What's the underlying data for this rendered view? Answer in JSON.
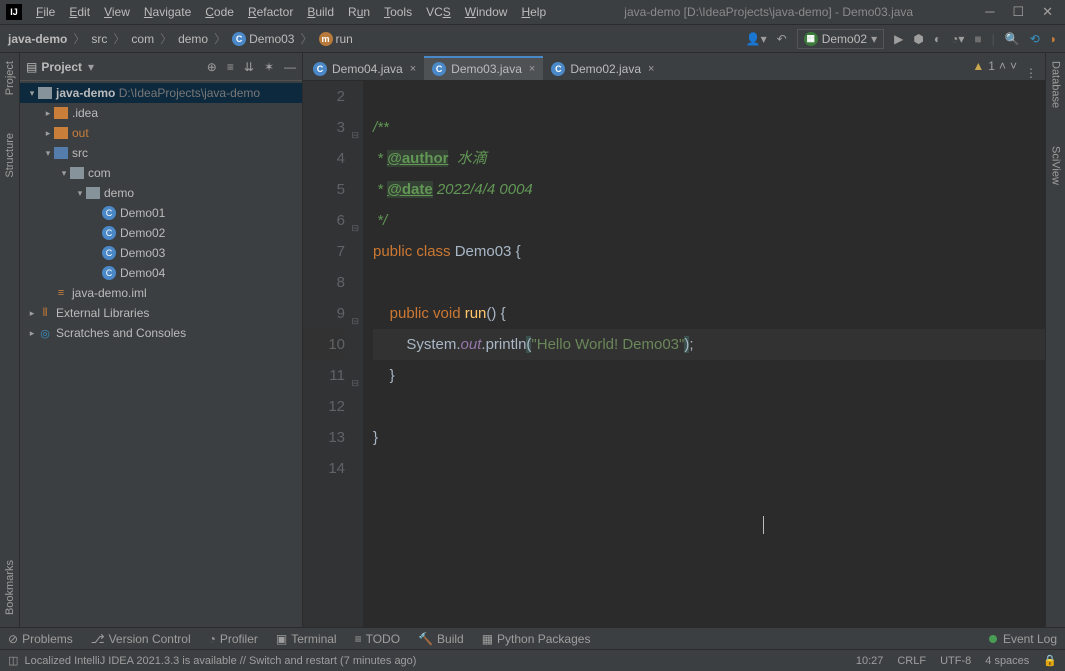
{
  "window": {
    "title": "java-demo [D:\\IdeaProjects\\java-demo] - Demo03.java"
  },
  "menu": [
    "File",
    "Edit",
    "View",
    "Navigate",
    "Code",
    "Refactor",
    "Build",
    "Run",
    "Tools",
    "VCS",
    "Window",
    "Help"
  ],
  "breadcrumb": {
    "project": "java-demo",
    "src": "src",
    "pkg1": "com",
    "pkg2": "demo",
    "class": "Demo03",
    "method": "run"
  },
  "run_config": "Demo02",
  "projectPanel": {
    "title": "Project",
    "root": "java-demo",
    "rootPath": "D:\\IdeaProjects\\java-demo",
    "idea": ".idea",
    "out": "out",
    "src": "src",
    "com": "com",
    "demo": "demo",
    "files": [
      "Demo01",
      "Demo02",
      "Demo03",
      "Demo04"
    ],
    "iml": "java-demo.iml",
    "ext": "External Libraries",
    "scratch": "Scratches and Consoles"
  },
  "leftTabs": [
    "Project",
    "Structure"
  ],
  "leftBottomTab": "Bookmarks",
  "rightTabs": [
    "Database",
    "SciView"
  ],
  "tabs": [
    {
      "name": "Demo04.java",
      "active": false
    },
    {
      "name": "Demo03.java",
      "active": true
    },
    {
      "name": "Demo02.java",
      "active": false
    }
  ],
  "editor": {
    "warnCount": "1",
    "lines": {
      "2": "",
      "3": "/**",
      "4_pre": " * ",
      "4_tag": "@author",
      "4_txt": "  水滴",
      "5_pre": " * ",
      "5_tag": "@date",
      "5_txt": " 2022/4/4 0004",
      "6": " */",
      "7_kw": "public class ",
      "7_cls": "Demo03 ",
      "7_br": "{",
      "8": "",
      "9_ind": "    ",
      "9_kw": "public void ",
      "9_m": "run",
      "9_rest": "() {",
      "10_ind": "        ",
      "10_sys": "System.",
      "10_out": "out",
      "10_dot": ".",
      "10_meth": "println",
      "10_p1": "(",
      "10_str": "\"Hello World! Demo03\"",
      "10_p2": ")",
      "10_semi": ";",
      "11": "    }",
      "12": "",
      "13": "}",
      "14": ""
    }
  },
  "bottomTools": {
    "problems": "Problems",
    "vcs": "Version Control",
    "profiler": "Profiler",
    "terminal": "Terminal",
    "todo": "TODO",
    "build": "Build",
    "python": "Python Packages",
    "eventlog": "Event Log"
  },
  "status": {
    "msg": "Localized IntelliJ IDEA 2021.3.3 is available // Switch and restart (7 minutes ago)",
    "pos": "10:27",
    "eol": "CRLF",
    "enc": "UTF-8",
    "indent": "4 spaces"
  }
}
